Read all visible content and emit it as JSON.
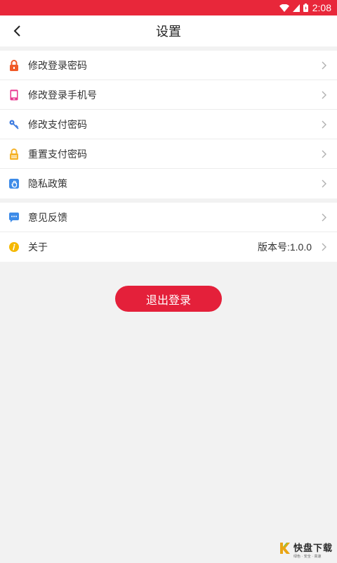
{
  "status_bar": {
    "time": "2:08"
  },
  "header": {
    "title": "设置",
    "back_icon": "chevron-left-icon"
  },
  "group1": [
    {
      "id": "change-login-password",
      "label": "修改登录密码",
      "icon": "lock-icon",
      "icon_color": "#f05a28"
    },
    {
      "id": "change-login-phone",
      "label": "修改登录手机号",
      "icon": "phone-icon",
      "icon_color": "#e8368f"
    },
    {
      "id": "change-pay-password",
      "label": "修改支付密码",
      "icon": "key-icon",
      "icon_color": "#3d7be0"
    },
    {
      "id": "reset-pay-password",
      "label": "重置支付密码",
      "icon": "lock-icon",
      "icon_color": "#f5b32a"
    },
    {
      "id": "privacy-policy",
      "label": "隐私政策",
      "icon": "hand-icon",
      "icon_color": "#3d8be8"
    }
  ],
  "group2": [
    {
      "id": "feedback",
      "label": "意见反馈",
      "icon": "chat-icon",
      "icon_color": "#3d8be8"
    },
    {
      "id": "about",
      "label": "关于",
      "icon": "info-icon",
      "icon_color": "#f5b800",
      "value": "版本号:1.0.0"
    }
  ],
  "logout_label": "退出登录",
  "colors": {
    "accent": "#e4203a",
    "status_bar": "#e8273a"
  },
  "watermark": {
    "main": "快盘下载",
    "sub": "绿色 · 安全 · 高速"
  }
}
